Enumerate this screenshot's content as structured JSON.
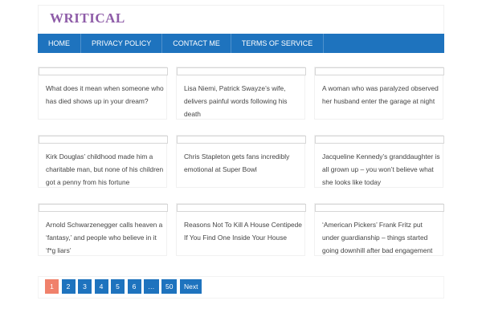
{
  "site": {
    "logo": "WRITICAL"
  },
  "nav": {
    "items": [
      {
        "label": "HOME"
      },
      {
        "label": "PRIVACY POLICY"
      },
      {
        "label": "CONTACT ME"
      },
      {
        "label": "TERMS OF SERVICE"
      }
    ]
  },
  "articles": [
    {
      "title": "What does it mean when someone who has died shows up in your dream?"
    },
    {
      "title": "Lisa Niemi, Patrick Swayze’s wife, delivers painful words following his death"
    },
    {
      "title": "A woman who was paralyzed observed her husband enter the garage at night"
    },
    {
      "title": "Kirk Douglas’ childhood made him a charitable man, but none of his children got a penny from his fortune"
    },
    {
      "title": "Chris Stapleton gets fans incredibly emotional at Super Bowl"
    },
    {
      "title": "Jacqueline Kennedy’s granddaughter is all grown up – you won’t believe what she looks like today"
    },
    {
      "title": "Arnold Schwarzenegger calls heaven a ‘fantasy,’ and people who believe in it ‘f*g liars’"
    },
    {
      "title": "Reasons Not To Kill A House Centipede If You Find One Inside Your House"
    },
    {
      "title": "‘American Pickers’ Frank Fritz put under guardianship – things started going downhill after bad engagement"
    }
  ],
  "pagination": {
    "pages": [
      "1",
      "2",
      "3",
      "4",
      "5",
      "6",
      "…",
      "50",
      "Next"
    ],
    "current": "1"
  },
  "colors": {
    "brand": "#8e5ca8",
    "nav": "#1e73be",
    "current_page": "#f0816b"
  }
}
